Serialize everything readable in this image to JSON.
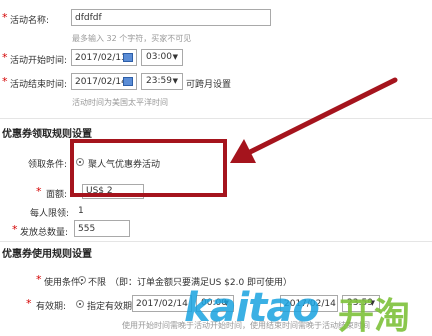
{
  "activity": {
    "name_label": "活动名称:",
    "name_value": "dfdfdf",
    "name_hint": "最多输入 32 个字符，买家不可见",
    "start_label": "活动开始时间:",
    "start_date": "2017/02/13",
    "start_time": "03:00",
    "end_label": "活动结束时间:",
    "end_date": "2017/02/14",
    "end_time": "23:59",
    "end_suffix": "可跨月设置",
    "timezone_hint": "活动时间为美国太平洋时间"
  },
  "claim_rules": {
    "section_title": "优惠券领取规则设置",
    "condition_label": "领取条件:",
    "condition_option": "聚人气优惠券活动",
    "amount_label": "面额:",
    "amount_value": "US$ 2",
    "per_person_label": "每人限领:",
    "per_person_value": "1",
    "total_label": "发放总数量:",
    "total_value": "555"
  },
  "usage_rules": {
    "section_title": "优惠券使用规则设置",
    "condition_label": "使用条件:",
    "condition_option": "不限",
    "condition_note": "（即：订单金额只要满足US $2.0 即可使用）",
    "validity_label": "有效期:",
    "validity_option": "指定有效期",
    "validity_date": "2017/02/14",
    "validity_time": "00:00",
    "validity_end_date": "2017/02/14",
    "validity_end_time": "23:59",
    "validity_hint": "使用开始时间需晚于活动开始时间，使用结束时间需晚于活动结束时间"
  },
  "watermark": {
    "en": "kaitao",
    "cn": "开淘"
  },
  "colors": {
    "highlight": "#a5141d",
    "required": "#d40000",
    "watermark_blue": "#1aa3e0",
    "watermark_green": "#7ec23a"
  }
}
